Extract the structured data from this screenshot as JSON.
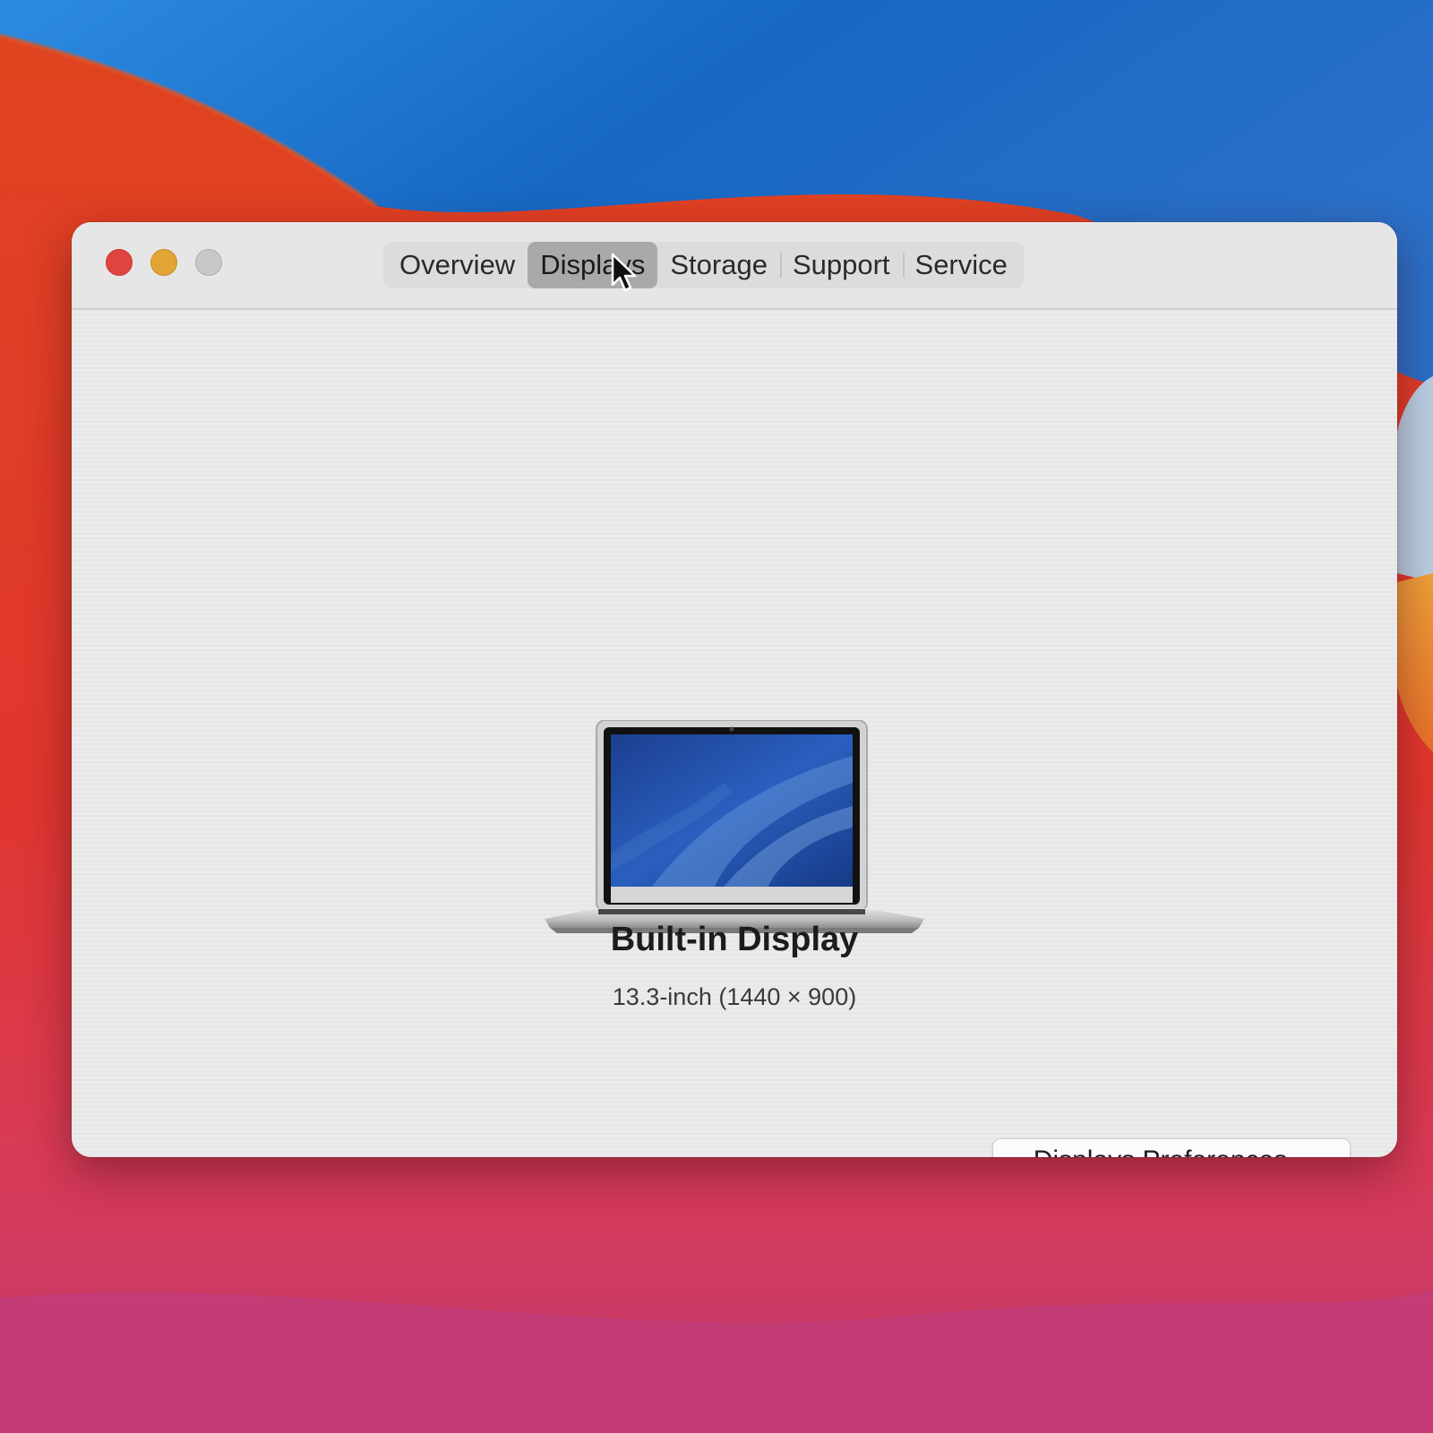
{
  "window": {
    "tabs": [
      {
        "label": "Overview",
        "active": false
      },
      {
        "label": "Displays",
        "active": true
      },
      {
        "label": "Storage",
        "active": false
      },
      {
        "label": "Support",
        "active": false
      },
      {
        "label": "Service",
        "active": false
      }
    ]
  },
  "display": {
    "name": "Built-in Display",
    "spec": "13.3-inch (1440 × 900)",
    "icon": "laptop-icon"
  },
  "actions": {
    "preferences_label": "Displays Preferences..."
  },
  "colors": {
    "close": "#e0443e",
    "minimize": "#e3a436",
    "zoom_disabled": "#c8c8c8",
    "active_tab": "#a9a9a9",
    "wallpaper_blue": "#1a6fc7",
    "wallpaper_red": "#e03a2c",
    "wallpaper_pink": "#c93a6a"
  }
}
